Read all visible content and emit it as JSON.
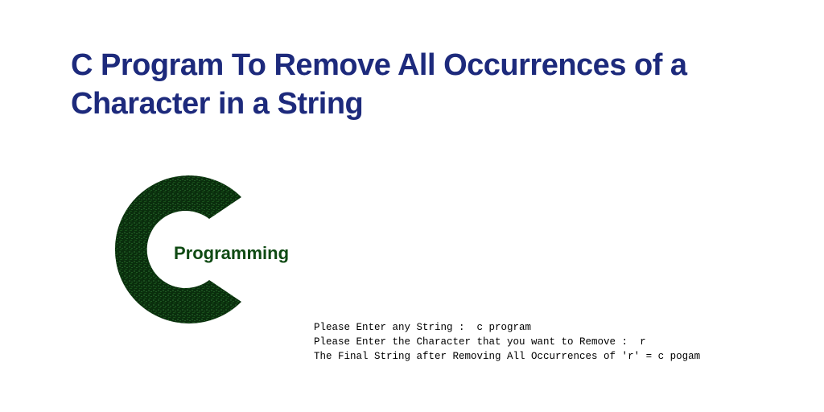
{
  "title": "C Program To Remove All Occurrences of a Character in a String",
  "logo": {
    "letter_glyph": "C",
    "label": "Programming"
  },
  "console": {
    "line1": "Please Enter any String :  c program",
    "line2": "Please Enter the Character that you want to Remove :  r",
    "line3": "The Final String after Removing All Occurrences of 'r' = c pogam"
  }
}
